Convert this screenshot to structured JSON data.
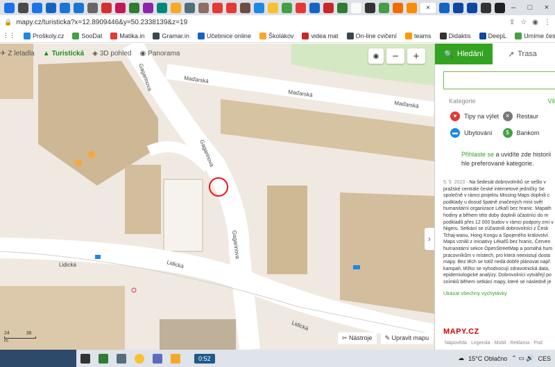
{
  "browser": {
    "tab_colors": [
      "#1a73e8",
      "#4a4a4a",
      "#1a73e8",
      "#1565c0",
      "#1976d2",
      "#1976d2",
      "#666",
      "#d32f2f",
      "#c2185b",
      "#2e7d32",
      "#8e24aa",
      "#00897b",
      "#f9a825",
      "#546e7a",
      "#8d6e63",
      "#e53935",
      "#e53935",
      "#6d4c41",
      "#1e88e5",
      "#fbc02d",
      "#43a047",
      "#e53935",
      "#1565c0",
      "#c62828",
      "#2e7d32",
      "#fafafa",
      "#333",
      "#43a047",
      "#ef6c00",
      "#fb8c00",
      "#1565c0",
      "#0d47a1",
      "#0d47a1",
      "#333",
      "#212121",
      "#1976d2"
    ],
    "active_tab_close": "×",
    "new_tab": "+",
    "url": "mapy.cz/turisticka?x=12.8909446&y=50.2338139&z=19",
    "window_min": "–",
    "window_max": "□",
    "window_close": "×"
  },
  "bookmarks": [
    {
      "label": "Proškoly.cz",
      "color": "#1e88e5"
    },
    {
      "label": "SooDat",
      "color": "#43a047"
    },
    {
      "label": "Matika.in",
      "color": "#e53935"
    },
    {
      "label": "Gramar.in",
      "color": "#37474f"
    },
    {
      "label": "Učebnice online",
      "color": "#1565c0"
    },
    {
      "label": "Školákov",
      "color": "#f9a825"
    },
    {
      "label": "videa mat",
      "color": "#c62828"
    },
    {
      "label": "On-line cvičení",
      "color": "#37474f"
    },
    {
      "label": "teams",
      "color": "#ff9800"
    },
    {
      "label": "Didaktis",
      "color": "#333"
    },
    {
      "label": "DeepL",
      "color": "#0d47a1"
    },
    {
      "label": "Umíme česky",
      "color": "#43a047"
    },
    {
      "label": "English Club",
      "color": "#37474f"
    }
  ],
  "map": {
    "tools": [
      "Z letadla",
      "Turistická",
      "3D pohled",
      "Panorama"
    ],
    "active_tool": "Turistická",
    "zoom_in": "+",
    "zoom_out": "−",
    "streets": {
      "madarska_1": "Maďarská",
      "madarska_2": "Maďarská",
      "madarska_3": "Maďarská",
      "gagarinova_1": "Gagarinova",
      "gagarinova_2": "Gagarinova",
      "gagarinova_3": "Gagarinova",
      "lidicka_1": "Lidická",
      "lidicka_2": "Lidická",
      "lidicka_3": "Lidická"
    },
    "bottom_tools": [
      "Nástroje",
      "Upravit mapu"
    ],
    "scale_left": "24",
    "scale_right": "36",
    "scale_unit": "m",
    "collapse_arrow": "›"
  },
  "panel": {
    "tab_search": "Hledání",
    "tab_route": "Trasa",
    "categories_label": "Kategorie",
    "categories_all": "Vš",
    "categories": [
      {
        "label": "Tipy na výlet",
        "color": "#e53935"
      },
      {
        "label": "Restaur",
        "color": "#777"
      },
      {
        "label": "Ubytování",
        "color": "#1e88e5"
      },
      {
        "label": "Bankom",
        "color": "#43a047"
      }
    ],
    "login_link": "Přihlaste se",
    "login_text": " a uvidíte zde historii hle preferované kategorie.",
    "news_date": "5. 5. 2023",
    "news_text": "Na šedesát dobrovolníků se sešlo v pražské centrále české internetové jedničky Se společně v rámci projektu Missing Maps doplnili c podklady u dosud špatně značených míst svět humanitární organizace Lékaři bez hranic. Mapath hodiny a během této doby doplnili účastníci do m podkladů přes 12 000 budov v rámci podpory zmí v Nigeru. Setkání se zúčastnili dobrovolníci z Česk Tchaj-wanu, Hong Kongu a Spojeného království. Maps vznikl z iniciativy Lékařů bez hranic, Červen humanitární sekce OpenStreetMap a pomáhá hum pracovníkům v místech, pro která neexistují dosta mapy. Bez těch se totiž nedá dobře plánovat např. kampaň, těžko se vyhodnocují zdravotnická data, epidemiologické analýzy. Dobrovolníci vytvářejí po snímků během setkání mapy, které se následně je",
    "all_news": "Ukázat všechny vychytávky",
    "logo": "MAPY.CZ",
    "footer": "Nápověda · Legenda · Mobil · Reklama · Pod"
  },
  "taskbar": {
    "time_badge": "0:52",
    "weather": "15°C  Oblačno",
    "lang": "CES"
  }
}
